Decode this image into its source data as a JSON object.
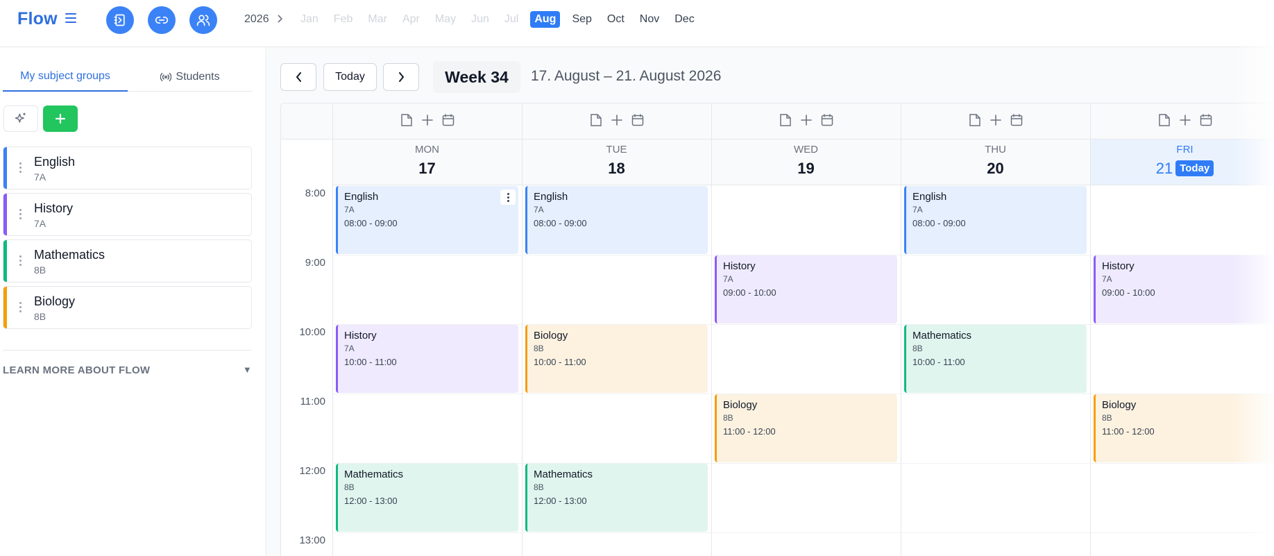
{
  "app": {
    "title": "Flow"
  },
  "header": {
    "year": "2026",
    "months": [
      {
        "label": "Jan",
        "state": "past"
      },
      {
        "label": "Feb",
        "state": "past"
      },
      {
        "label": "Mar",
        "state": "past"
      },
      {
        "label": "Apr",
        "state": "past"
      },
      {
        "label": "May",
        "state": "past"
      },
      {
        "label": "Jun",
        "state": "past"
      },
      {
        "label": "Jul",
        "state": "past"
      },
      {
        "label": "Aug",
        "state": "current"
      },
      {
        "label": "Sep",
        "state": "future"
      },
      {
        "label": "Oct",
        "state": "future"
      },
      {
        "label": "Nov",
        "state": "future"
      },
      {
        "label": "Dec",
        "state": "future"
      }
    ],
    "icons": [
      "notebook-icon",
      "link-icon",
      "users-icon"
    ]
  },
  "sidebar": {
    "tabs": [
      {
        "label": "My subject groups",
        "active": true
      },
      {
        "label": "Students",
        "active": false
      }
    ],
    "groups": [
      {
        "name": "English",
        "class": "7A",
        "color": "#3b82f6"
      },
      {
        "name": "History",
        "class": "7A",
        "color": "#8b5cf6"
      },
      {
        "name": "Mathematics",
        "class": "8B",
        "color": "#10b981"
      },
      {
        "name": "Biology",
        "class": "8B",
        "color": "#f59e0b"
      }
    ],
    "learn_more": "LEARN MORE ABOUT FLOW"
  },
  "toolbar": {
    "today_label": "Today",
    "week_label": "Week 34",
    "date_range": "17. August – 21. August 2026"
  },
  "calendar": {
    "today_badge": "Today",
    "hours": [
      "8:00",
      "9:00",
      "10:00",
      "11:00",
      "12:00",
      "13:00"
    ],
    "days": [
      {
        "name": "MON",
        "num": "17",
        "today": false
      },
      {
        "name": "TUE",
        "num": "18",
        "today": false
      },
      {
        "name": "WED",
        "num": "19",
        "today": false
      },
      {
        "name": "THU",
        "num": "20",
        "today": false
      },
      {
        "name": "FRI",
        "num": "21",
        "today": true
      }
    ],
    "events": [
      {
        "day": 0,
        "start": 8,
        "subject": "English",
        "class": "7A",
        "time": "08:00 - 09:00",
        "type": "english",
        "menu": true
      },
      {
        "day": 1,
        "start": 8,
        "subject": "English",
        "class": "7A",
        "time": "08:00 - 09:00",
        "type": "english"
      },
      {
        "day": 3,
        "start": 8,
        "subject": "English",
        "class": "7A",
        "time": "08:00 - 09:00",
        "type": "english"
      },
      {
        "day": 2,
        "start": 9,
        "subject": "History",
        "class": "7A",
        "time": "09:00 - 10:00",
        "type": "history"
      },
      {
        "day": 4,
        "start": 9,
        "subject": "History",
        "class": "7A",
        "time": "09:00 - 10:00",
        "type": "history"
      },
      {
        "day": 0,
        "start": 10,
        "subject": "History",
        "class": "7A",
        "time": "10:00 - 11:00",
        "type": "history"
      },
      {
        "day": 1,
        "start": 10,
        "subject": "Biology",
        "class": "8B",
        "time": "10:00 - 11:00",
        "type": "biology"
      },
      {
        "day": 3,
        "start": 10,
        "subject": "Mathematics",
        "class": "8B",
        "time": "10:00 - 11:00",
        "type": "math"
      },
      {
        "day": 2,
        "start": 11,
        "subject": "Biology",
        "class": "8B",
        "time": "11:00 - 12:00",
        "type": "biology"
      },
      {
        "day": 4,
        "start": 11,
        "subject": "Biology",
        "class": "8B",
        "time": "11:00 - 12:00",
        "type": "biology"
      },
      {
        "day": 0,
        "start": 12,
        "subject": "Mathematics",
        "class": "8B",
        "time": "12:00 - 13:00",
        "type": "math"
      },
      {
        "day": 1,
        "start": 12,
        "subject": "Mathematics",
        "class": "8B",
        "time": "12:00 - 13:00",
        "type": "math"
      }
    ],
    "colors": {
      "english": {
        "bg": "#e6effd",
        "border": "#3b82f6"
      },
      "history": {
        "bg": "#efeafd",
        "border": "#8b5cf6"
      },
      "math": {
        "bg": "#e0f5ee",
        "border": "#10b981"
      },
      "biology": {
        "bg": "#fdf2e0",
        "border": "#f59e0b"
      }
    }
  }
}
